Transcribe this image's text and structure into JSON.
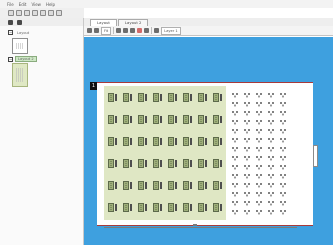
{
  "menu": [
    "File",
    "Edit",
    "View",
    "Help"
  ],
  "tabs": [
    {
      "label": "Layout",
      "active": true
    },
    {
      "label": "Layout 2",
      "active": false
    }
  ],
  "tree": {
    "items": [
      {
        "label": "Layout",
        "expanded": true
      },
      {
        "label": "Layout 2",
        "expanded": true,
        "selected": true
      }
    ]
  },
  "viewbar": {
    "zoom": "Fit",
    "layer": "Layer 1"
  },
  "sheet": {
    "title": "",
    "subtitle": ""
  },
  "icons": [
    "new-icon",
    "open-icon",
    "save-icon",
    "print-icon",
    "undo-icon",
    "redo-icon",
    "zoom-icon",
    "select-icon",
    "move-icon",
    "grid-icon",
    "layer-icon"
  ],
  "colors": {
    "canvas": "#3ea0df",
    "section_a": "#dfe7c4",
    "sheet_border": "#a83a3a"
  }
}
